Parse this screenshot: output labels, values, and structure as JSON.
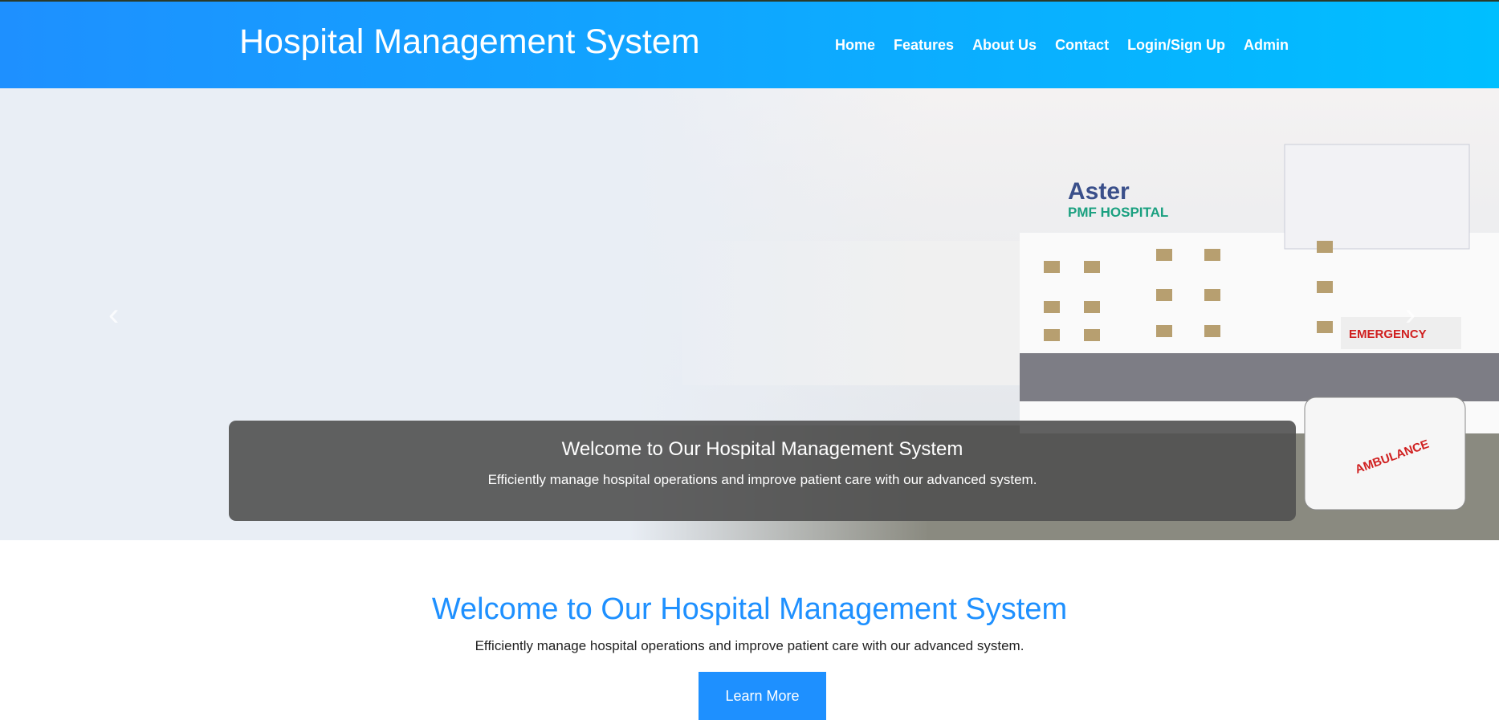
{
  "header": {
    "title": "Hospital Management System",
    "nav": [
      "Home",
      "Features",
      "About Us",
      "Contact",
      "Login/Sign Up",
      "Admin"
    ]
  },
  "hero": {
    "sign_line1": "Aster",
    "sign_line2": "PMF HOSPITAL",
    "emergency": "EMERGENCY",
    "ambulance": "AMBULANCE",
    "caption_title": "Welcome to Our Hospital Management System",
    "caption_text": "Efficiently manage hospital operations and improve patient care with our advanced system.",
    "prev": "‹",
    "next": "›"
  },
  "welcome": {
    "title": "Welcome to Our Hospital Management System",
    "text": "Efficiently manage hospital operations and improve patient care with our advanced system.",
    "button": "Learn More"
  }
}
